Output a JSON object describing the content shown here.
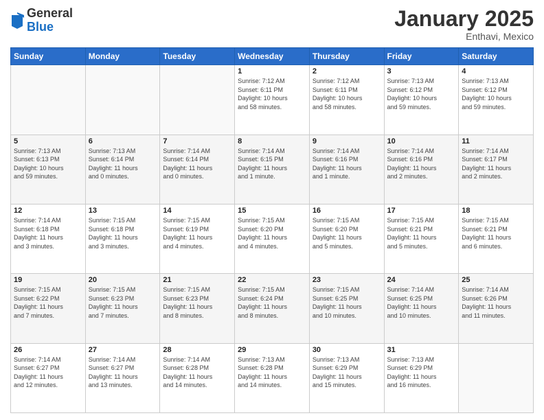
{
  "logo": {
    "general": "General",
    "blue": "Blue"
  },
  "header": {
    "month": "January 2025",
    "location": "Enthavi, Mexico"
  },
  "days_of_week": [
    "Sunday",
    "Monday",
    "Tuesday",
    "Wednesday",
    "Thursday",
    "Friday",
    "Saturday"
  ],
  "weeks": [
    [
      {
        "day": "",
        "info": ""
      },
      {
        "day": "",
        "info": ""
      },
      {
        "day": "",
        "info": ""
      },
      {
        "day": "1",
        "info": "Sunrise: 7:12 AM\nSunset: 6:11 PM\nDaylight: 10 hours\nand 58 minutes."
      },
      {
        "day": "2",
        "info": "Sunrise: 7:12 AM\nSunset: 6:11 PM\nDaylight: 10 hours\nand 58 minutes."
      },
      {
        "day": "3",
        "info": "Sunrise: 7:13 AM\nSunset: 6:12 PM\nDaylight: 10 hours\nand 59 minutes."
      },
      {
        "day": "4",
        "info": "Sunrise: 7:13 AM\nSunset: 6:12 PM\nDaylight: 10 hours\nand 59 minutes."
      }
    ],
    [
      {
        "day": "5",
        "info": "Sunrise: 7:13 AM\nSunset: 6:13 PM\nDaylight: 10 hours\nand 59 minutes."
      },
      {
        "day": "6",
        "info": "Sunrise: 7:13 AM\nSunset: 6:14 PM\nDaylight: 11 hours\nand 0 minutes."
      },
      {
        "day": "7",
        "info": "Sunrise: 7:14 AM\nSunset: 6:14 PM\nDaylight: 11 hours\nand 0 minutes."
      },
      {
        "day": "8",
        "info": "Sunrise: 7:14 AM\nSunset: 6:15 PM\nDaylight: 11 hours\nand 1 minute."
      },
      {
        "day": "9",
        "info": "Sunrise: 7:14 AM\nSunset: 6:16 PM\nDaylight: 11 hours\nand 1 minute."
      },
      {
        "day": "10",
        "info": "Sunrise: 7:14 AM\nSunset: 6:16 PM\nDaylight: 11 hours\nand 2 minutes."
      },
      {
        "day": "11",
        "info": "Sunrise: 7:14 AM\nSunset: 6:17 PM\nDaylight: 11 hours\nand 2 minutes."
      }
    ],
    [
      {
        "day": "12",
        "info": "Sunrise: 7:14 AM\nSunset: 6:18 PM\nDaylight: 11 hours\nand 3 minutes."
      },
      {
        "day": "13",
        "info": "Sunrise: 7:15 AM\nSunset: 6:18 PM\nDaylight: 11 hours\nand 3 minutes."
      },
      {
        "day": "14",
        "info": "Sunrise: 7:15 AM\nSunset: 6:19 PM\nDaylight: 11 hours\nand 4 minutes."
      },
      {
        "day": "15",
        "info": "Sunrise: 7:15 AM\nSunset: 6:20 PM\nDaylight: 11 hours\nand 4 minutes."
      },
      {
        "day": "16",
        "info": "Sunrise: 7:15 AM\nSunset: 6:20 PM\nDaylight: 11 hours\nand 5 minutes."
      },
      {
        "day": "17",
        "info": "Sunrise: 7:15 AM\nSunset: 6:21 PM\nDaylight: 11 hours\nand 5 minutes."
      },
      {
        "day": "18",
        "info": "Sunrise: 7:15 AM\nSunset: 6:21 PM\nDaylight: 11 hours\nand 6 minutes."
      }
    ],
    [
      {
        "day": "19",
        "info": "Sunrise: 7:15 AM\nSunset: 6:22 PM\nDaylight: 11 hours\nand 7 minutes."
      },
      {
        "day": "20",
        "info": "Sunrise: 7:15 AM\nSunset: 6:23 PM\nDaylight: 11 hours\nand 7 minutes."
      },
      {
        "day": "21",
        "info": "Sunrise: 7:15 AM\nSunset: 6:23 PM\nDaylight: 11 hours\nand 8 minutes."
      },
      {
        "day": "22",
        "info": "Sunrise: 7:15 AM\nSunset: 6:24 PM\nDaylight: 11 hours\nand 8 minutes."
      },
      {
        "day": "23",
        "info": "Sunrise: 7:15 AM\nSunset: 6:25 PM\nDaylight: 11 hours\nand 10 minutes."
      },
      {
        "day": "24",
        "info": "Sunrise: 7:14 AM\nSunset: 6:25 PM\nDaylight: 11 hours\nand 10 minutes."
      },
      {
        "day": "25",
        "info": "Sunrise: 7:14 AM\nSunset: 6:26 PM\nDaylight: 11 hours\nand 11 minutes."
      }
    ],
    [
      {
        "day": "26",
        "info": "Sunrise: 7:14 AM\nSunset: 6:27 PM\nDaylight: 11 hours\nand 12 minutes."
      },
      {
        "day": "27",
        "info": "Sunrise: 7:14 AM\nSunset: 6:27 PM\nDaylight: 11 hours\nand 13 minutes."
      },
      {
        "day": "28",
        "info": "Sunrise: 7:14 AM\nSunset: 6:28 PM\nDaylight: 11 hours\nand 14 minutes."
      },
      {
        "day": "29",
        "info": "Sunrise: 7:13 AM\nSunset: 6:28 PM\nDaylight: 11 hours\nand 14 minutes."
      },
      {
        "day": "30",
        "info": "Sunrise: 7:13 AM\nSunset: 6:29 PM\nDaylight: 11 hours\nand 15 minutes."
      },
      {
        "day": "31",
        "info": "Sunrise: 7:13 AM\nSunset: 6:29 PM\nDaylight: 11 hours\nand 16 minutes."
      },
      {
        "day": "",
        "info": ""
      }
    ]
  ]
}
